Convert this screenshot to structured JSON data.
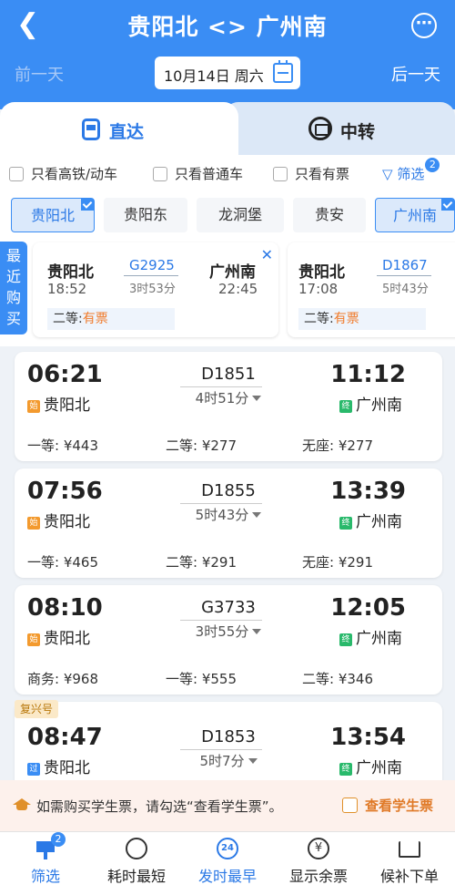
{
  "header": {
    "title": "贵阳北 <> 广州南",
    "prev_day": "前一天",
    "next_day": "后一天",
    "date": "10月14日 周六"
  },
  "tabs": [
    {
      "label": "直达",
      "active": true
    },
    {
      "label": "中转",
      "active": false
    }
  ],
  "filters": {
    "checkboxes": [
      "只看高铁/动车",
      "只看普通车",
      "只看有票"
    ],
    "filter_label": "筛选",
    "filter_count": "2"
  },
  "stations": [
    {
      "name": "贵阳北",
      "selected": true
    },
    {
      "name": "贵阳东",
      "selected": false
    },
    {
      "name": "龙洞堡",
      "selected": false
    },
    {
      "name": "贵安",
      "selected": false
    },
    {
      "name": "广州南",
      "selected": true
    }
  ],
  "recent": {
    "tag": "最近购买",
    "cards": [
      {
        "from": "贵阳北",
        "from_time": "18:52",
        "train": "G2925",
        "duration": "3时53分",
        "to": "广州南",
        "to_time": "22:45",
        "seat": "二等:",
        "status": "有票"
      },
      {
        "from": "贵阳北",
        "from_time": "17:08",
        "train": "D1867",
        "duration": "5时43分",
        "to": "",
        "to_time": "",
        "seat": "二等:",
        "status": "有票"
      }
    ]
  },
  "trains": [
    {
      "dep": "06:21",
      "arr": "11:12",
      "no": "D1851",
      "duration": "4时51分",
      "from": "贵阳北",
      "to": "广州南",
      "from_mark": "始",
      "to_mark": "终",
      "prices": [
        "一等: ¥443",
        "二等: ¥277",
        "无座: ¥277"
      ]
    },
    {
      "dep": "07:56",
      "arr": "13:39",
      "no": "D1855",
      "duration": "5时43分",
      "from": "贵阳北",
      "to": "广州南",
      "from_mark": "始",
      "to_mark": "终",
      "prices": [
        "一等: ¥465",
        "二等: ¥291",
        "无座: ¥291"
      ]
    },
    {
      "dep": "08:10",
      "arr": "12:05",
      "no": "G3733",
      "duration": "3时55分",
      "from": "贵阳北",
      "to": "广州南",
      "from_mark": "始",
      "to_mark": "终",
      "prices": [
        "商务: ¥968",
        "一等: ¥555",
        "二等: ¥346"
      ]
    },
    {
      "dep": "08:47",
      "arr": "13:54",
      "no": "D1853",
      "duration": "5时7分",
      "from": "贵阳北",
      "to": "广州南",
      "from_mark": "过",
      "to_mark": "终",
      "badge": "复兴号",
      "prices": []
    }
  ],
  "notice": {
    "text": "如需购买学生票，请勾选“查看学生票”。",
    "checkbox_label": "查看学生票"
  },
  "bottom_bar": [
    {
      "label": "筛选",
      "badge": "2",
      "icon": "funnel-icon"
    },
    {
      "label": "耗时最短",
      "icon": "timer-icon"
    },
    {
      "label": "发时最早",
      "icon_text": "24",
      "icon": "clock-24-icon"
    },
    {
      "label": "显示余票",
      "icon_text": "¥",
      "icon": "yen-icon"
    },
    {
      "label": "候补下单",
      "icon": "cart-icon"
    }
  ],
  "colors": {
    "primary": "#3a8df4",
    "accent_orange": "#f07a2a",
    "start_mark": "#f39a2e",
    "end_mark": "#29b96b"
  }
}
